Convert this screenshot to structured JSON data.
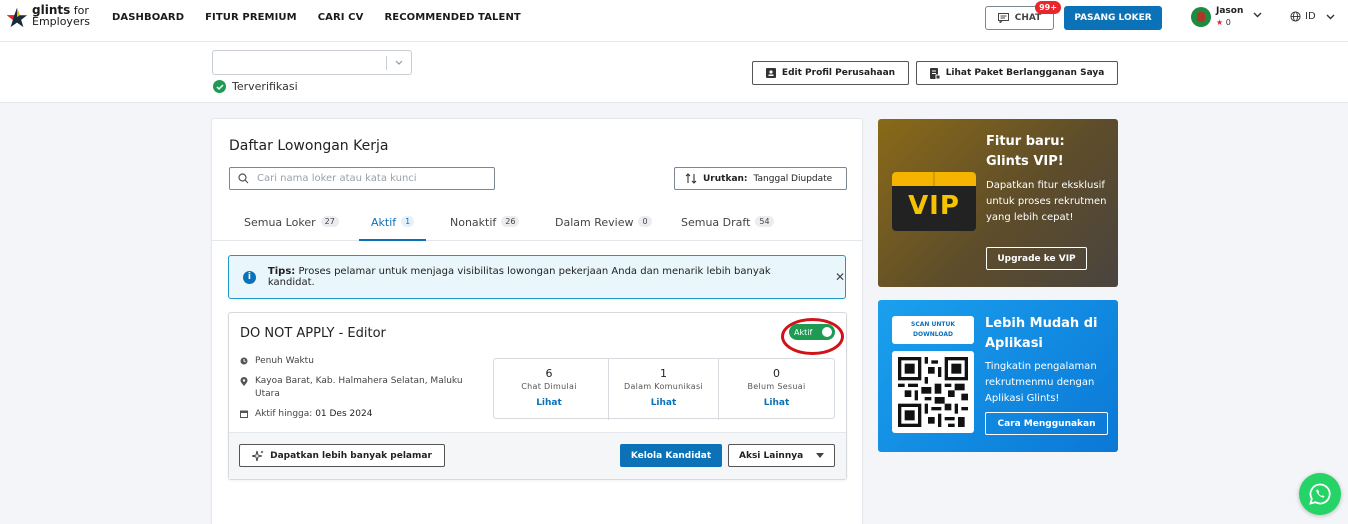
{
  "nav": {
    "logo_line1": "glints",
    "logo_line1_suffix": "for",
    "logo_line2": "Employers",
    "links": [
      "DASHBOARD",
      "FITUR PREMIUM",
      "CARI CV",
      "RECOMMENDED TALENT"
    ],
    "chat_label": "CHAT",
    "chat_badge": "99+",
    "post_job_label": "PASANG LOKER",
    "user_name": "Jason",
    "user_points": "0",
    "language": "ID"
  },
  "company": {
    "verified_label": "Terverifikasi",
    "edit_profile_label": "Edit Profil Perusahaan",
    "subscription_label": "Lihat Paket Berlangganan Saya"
  },
  "jobs": {
    "title": "Daftar Lowongan Kerja",
    "search_placeholder": "Cari nama loker atau kata kunci",
    "sort_label": "Urutkan:",
    "sort_value": "Tanggal Diupdate",
    "tabs": [
      {
        "label": "Semua Loker",
        "count": "27"
      },
      {
        "label": "Aktif",
        "count": "1"
      },
      {
        "label": "Nonaktif",
        "count": "26"
      },
      {
        "label": "Dalam Review",
        "count": "0"
      },
      {
        "label": "Semua Draft",
        "count": "54"
      }
    ],
    "active_tab": "Aktif",
    "tips_label": "Tips:",
    "tips_text": "Proses pelamar untuk menjaga visibilitas lowongan pekerjaan Anda dan menarik lebih banyak kandidat."
  },
  "job_card": {
    "title": "DO NOT APPLY - Editor",
    "status_label": "Aktif",
    "status_on": true,
    "job_type": "Penuh Waktu",
    "location_line1": "Kayoa Barat, Kab. Halmahera Selatan, Maluku",
    "location_line2": "Utara",
    "active_until_label": "Aktif hingga:",
    "active_until_value": "01 Des 2024",
    "stats": [
      {
        "value": "6",
        "label": "Chat Dimulai",
        "link": "Lihat"
      },
      {
        "value": "1",
        "label": "Dalam Komunikasi",
        "link": "Lihat"
      },
      {
        "value": "0",
        "label": "Belum Sesuai",
        "link": "Lihat"
      }
    ],
    "more_applicants_label": "Dapatkan lebih banyak pelamar",
    "manage_label": "Kelola Kandidat",
    "more_actions_label": "Aksi Lainnya"
  },
  "vip_card": {
    "badge": "VIP",
    "title": "Fitur baru: Glints VIP!",
    "description": "Dapatkan fitur eksklusif untuk proses rekrutmen yang lebih cepat!",
    "button": "Upgrade ke VIP"
  },
  "app_card": {
    "scan_label": "SCAN UNTUK DOWNLOAD",
    "title": "Lebih Mudah di Aplikasi",
    "description": "Tingkatin pengalaman rekrutmenmu dengan Aplikasi Glints!",
    "button": "Cara Menggunakan"
  },
  "colors": {
    "primary": "#0b72b8",
    "success": "#1e9a52",
    "danger": "#e8262b",
    "highlight_ring": "#d01318"
  }
}
